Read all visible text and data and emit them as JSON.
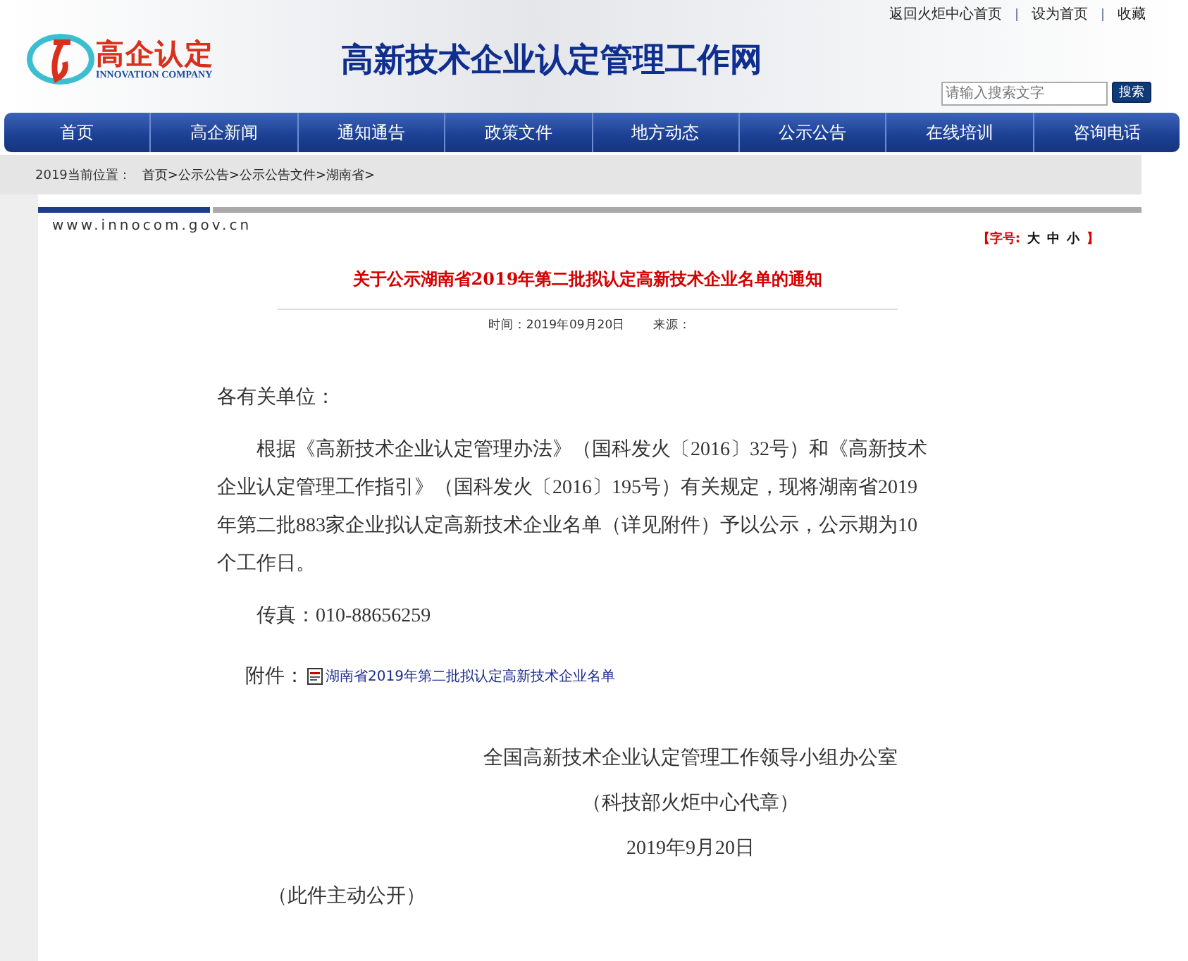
{
  "top_links": [
    "返回火炬中心首页",
    "设为首页",
    "收藏"
  ],
  "logo": {
    "name": "高企认定",
    "subtitle": "INNOVATION COMPANY"
  },
  "site_title": "高新技术企业认定管理工作网",
  "search": {
    "placeholder": "请输入搜索文字",
    "button": "搜索"
  },
  "nav": [
    "首页",
    "高企新闻",
    "通知通告",
    "政策文件",
    "地方动态",
    "公示公告",
    "在线培训",
    "咨询电话"
  ],
  "breadcrumb": {
    "label": "2019当前位置：",
    "path": "首页>公示公告>公示公告文件>湖南省>"
  },
  "site_url": "www.innocom.gov.cn",
  "font_size": {
    "label": "【字号:",
    "options": [
      "大",
      "中",
      "小"
    ],
    "end": "】"
  },
  "article": {
    "title": "关于公示湖南省2019年第二批拟认定高新技术企业名单的通知",
    "time": "时间：2019年09月20日",
    "source": "来源：",
    "greeting": "各有关单位：",
    "body": "根据《高新技术企业认定管理办法》（国科发火〔2016〕32号）和《高新技术企业认定管理工作指引》（国科发火〔2016〕195号）有关规定，现将湖南省2019年第二批883家企业拟认定高新技术企业名单（详见附件）予以公示，公示期为10个工作日。",
    "fax": "传真：010-88656259",
    "attachment_label": "附件：",
    "attachment_link": "湖南省2019年第二批拟认定高新技术企业名单",
    "signature": [
      "全国高新技术企业认定管理工作领导小组办公室",
      "（科技部火炬中心代章）",
      "2019年9月20日"
    ],
    "note": "（此件主动公开）"
  }
}
